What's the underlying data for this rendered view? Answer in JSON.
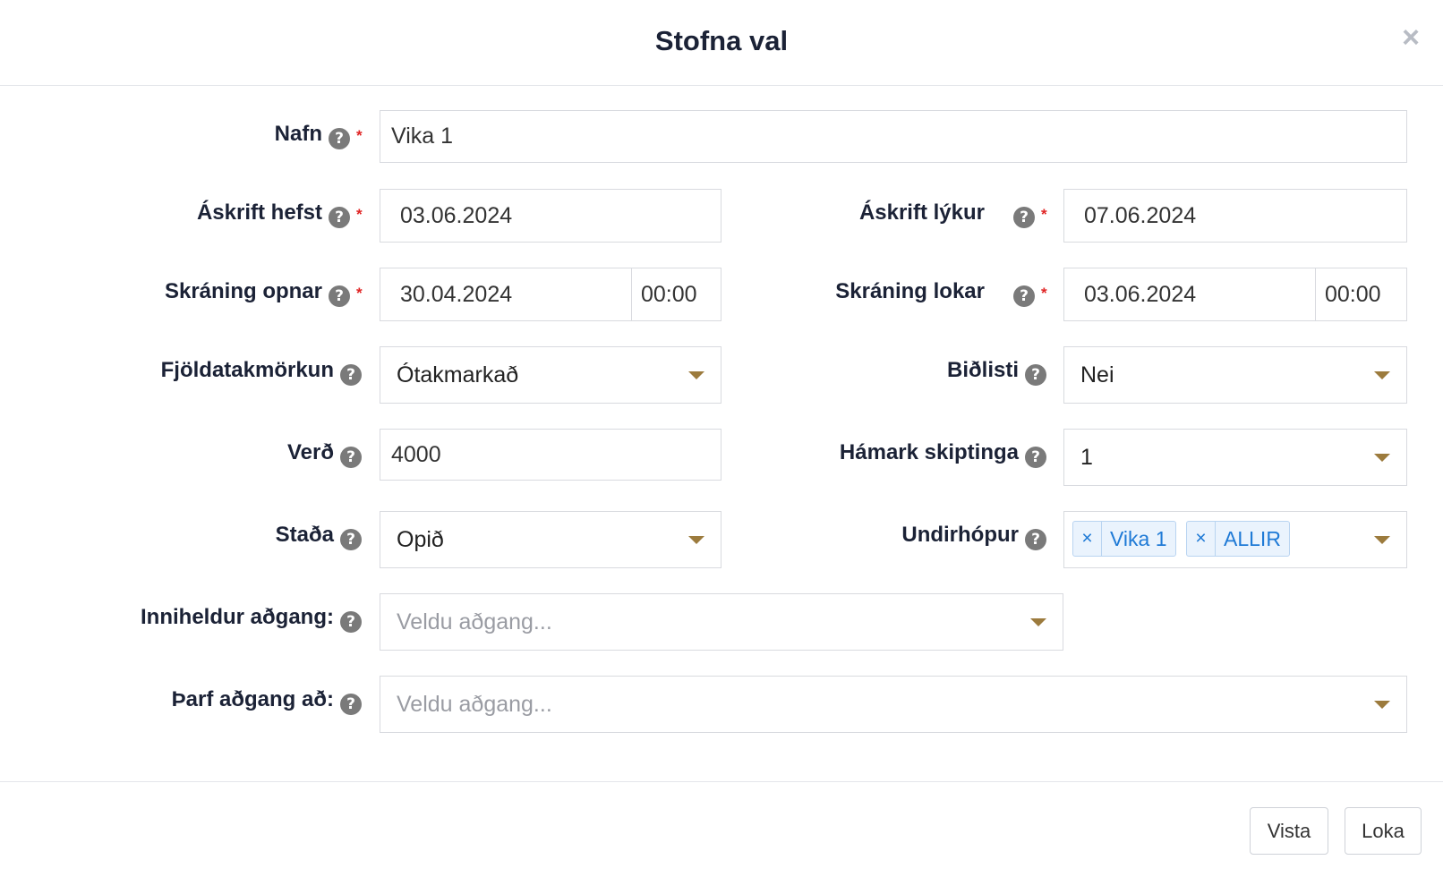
{
  "dialog": {
    "title": "Stofna val",
    "close": "×"
  },
  "form": {
    "name": {
      "label": "Nafn",
      "value": "Vika 1"
    },
    "subscription_start": {
      "label": "Áskrift hefst",
      "value": "03.06.2024"
    },
    "subscription_end": {
      "label": "Áskrift lýkur",
      "value": "07.06.2024"
    },
    "registration_opens": {
      "label": "Skráning opnar",
      "date": "30.04.2024",
      "time": "00:00"
    },
    "registration_closes": {
      "label": "Skráning lokar",
      "date": "03.06.2024",
      "time": "00:00"
    },
    "capacity_limit": {
      "label": "Fjöldatakmörkun",
      "value": "Ótakmarkað"
    },
    "waiting_list": {
      "label": "Biðlisti",
      "value": "Nei"
    },
    "price": {
      "label": "Verð",
      "value": "4000"
    },
    "max_installments": {
      "label": "Hámark skiptinga",
      "value": "1"
    },
    "status": {
      "label": "Staða",
      "value": "Opið"
    },
    "subgroup": {
      "label": "Undirhópur",
      "tags": [
        "Vika 1",
        "ALLIR"
      ]
    },
    "includes_access": {
      "label": "Inniheldur aðgang:",
      "placeholder": "Veldu aðgang..."
    },
    "requires_access": {
      "label": "Þarf aðgang að:",
      "placeholder": "Veldu aðgang..."
    },
    "help_glyph": "?",
    "required_glyph": "*",
    "remove_tag_glyph": "×"
  },
  "footer": {
    "save_label": "Vista",
    "close_label": "Loka"
  },
  "colors": {
    "caret": "#9c7b3d",
    "tag_text": "#1f7ad6",
    "required": "#e02424"
  }
}
